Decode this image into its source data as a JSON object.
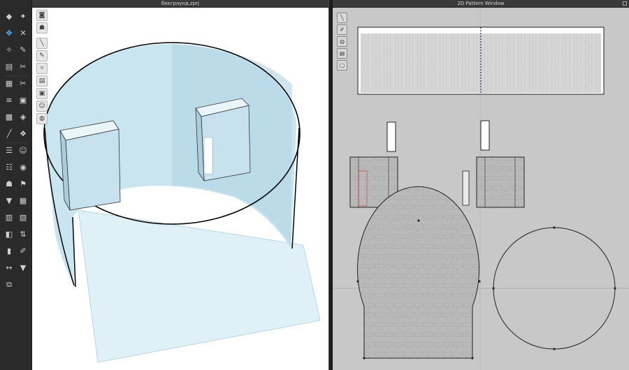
{
  "windows": {
    "view3d_title": "бекграунд.zprj",
    "pattern2d_title": "2D Pattern Window"
  },
  "colors": {
    "avatar_blue": "#cfe8f2",
    "dark_ui": "#2a2a2a",
    "pattern_bg": "#c8c8c8",
    "texture_gray": "#b5b5b5",
    "active_tool": "#4fb3ff",
    "seam_red": "#d04040"
  },
  "left_tools": [
    {
      "icon": "select-icon",
      "glyph": "◆"
    },
    {
      "icon": "move-figure-icon",
      "glyph": "✦"
    },
    {
      "icon": "transform-icon",
      "glyph": "✥",
      "active": true
    },
    {
      "icon": "pin-icon",
      "glyph": "✕"
    },
    {
      "icon": "edit-pattern-icon",
      "glyph": "✧"
    },
    {
      "icon": "brush-icon",
      "glyph": "✎"
    },
    {
      "icon": "fold-icon",
      "glyph": "▤"
    },
    {
      "icon": "tack-icon",
      "glyph": "✂"
    },
    {
      "icon": "measure-icon",
      "glyph": "▦"
    },
    {
      "icon": "cut-icon",
      "glyph": "✂"
    },
    {
      "icon": "segment-icon",
      "glyph": "≡"
    },
    {
      "icon": "fabric-icon",
      "glyph": "▣"
    },
    {
      "icon": "texture-icon",
      "glyph": "▩"
    },
    {
      "icon": "graphic-icon",
      "glyph": "◈"
    },
    {
      "icon": "line-icon",
      "glyph": "╱"
    },
    {
      "icon": "button-icon",
      "glyph": "❖"
    },
    {
      "icon": "zipper-icon",
      "glyph": "☰"
    },
    {
      "icon": "face-icon",
      "glyph": "☺"
    },
    {
      "icon": "puckering-icon",
      "glyph": "☷"
    },
    {
      "icon": "piping-icon",
      "glyph": "◉"
    },
    {
      "icon": "avatar-icon",
      "glyph": "☗"
    },
    {
      "icon": "hanger-icon",
      "glyph": "⚑"
    },
    {
      "icon": "shirt-icon",
      "glyph": "▼"
    },
    {
      "icon": "grid-icon",
      "glyph": "▦"
    },
    {
      "icon": "book-icon",
      "glyph": "▥"
    },
    {
      "icon": "layer-icon",
      "glyph": "▧"
    },
    {
      "icon": "gradient-icon",
      "glyph": "◧"
    },
    {
      "icon": "arrange-icon",
      "glyph": "⇅"
    },
    {
      "icon": "strip-icon",
      "glyph": "▮"
    },
    {
      "icon": "paint-icon",
      "glyph": "✐"
    },
    {
      "icon": "sym-icon",
      "glyph": "↔"
    },
    {
      "icon": "tshirt-icon",
      "glyph": "▼"
    },
    {
      "icon": "copy-icon",
      "glyph": "⧉"
    }
  ],
  "viewport_tools": [
    {
      "icon": "camera-icon",
      "glyph": "◙"
    },
    {
      "icon": "avatar-display-icon",
      "glyph": "☗"
    },
    {
      "icon": "needle-icon",
      "glyph": "╲"
    },
    {
      "icon": "brush-3d-icon",
      "glyph": "✎"
    },
    {
      "icon": "wand-icon",
      "glyph": "✧"
    },
    {
      "icon": "texture-view-icon",
      "glyph": "▤"
    },
    {
      "icon": "pattern-view-icon",
      "glyph": "▣"
    },
    {
      "icon": "skin-icon",
      "glyph": "☺"
    },
    {
      "icon": "globe-icon",
      "glyph": "◍"
    }
  ],
  "pattern_tools": [
    {
      "icon": "needle-2d-icon",
      "glyph": "╲"
    },
    {
      "icon": "pen-2d-icon",
      "glyph": "✐"
    },
    {
      "icon": "globe-2d-icon",
      "glyph": "◍"
    },
    {
      "icon": "fabric-2d-icon",
      "glyph": "▤"
    },
    {
      "icon": "lock-2d-icon",
      "glyph": "▢"
    }
  ]
}
